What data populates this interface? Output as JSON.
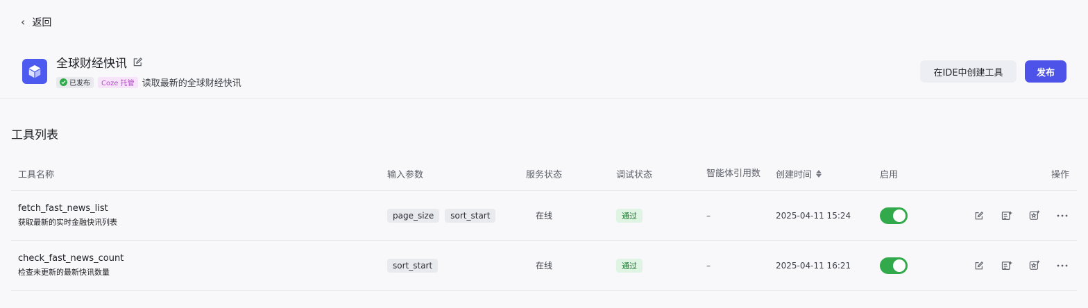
{
  "nav": {
    "back_label": "返回"
  },
  "plugin": {
    "title": "全球财经快讯",
    "published_label": "已发布",
    "hosted_label": "Coze 托管",
    "description": "读取最新的全球财经快讯",
    "logo_icon": "cube-icon",
    "logo_color": "#4c5af0"
  },
  "actions": {
    "ide_label": "在IDE中创建工具",
    "publish_label": "发布",
    "accent": "#4d53e8"
  },
  "section": {
    "title": "工具列表"
  },
  "table": {
    "headers": {
      "name": "工具名称",
      "params": "输入参数",
      "service": "服务状态",
      "debug": "调试状态",
      "refs": "智能体引用数",
      "created": "创建时间",
      "enabled": "启用",
      "ops": "操作"
    },
    "rows": [
      {
        "name": "fetch_fast_news_list",
        "desc": "获取最新的实时金融快讯列表",
        "params": [
          "page_size",
          "sort_start"
        ],
        "service": "在线",
        "debug": "通过",
        "refs": "–",
        "created": "2025-04-11 15:24",
        "enabled": true
      },
      {
        "name": "check_fast_news_count",
        "desc": "检查未更新的最新快讯数量",
        "params": [
          "sort_start"
        ],
        "service": "在线",
        "debug": "通过",
        "refs": "–",
        "created": "2025-04-11 16:21",
        "enabled": true
      }
    ]
  }
}
